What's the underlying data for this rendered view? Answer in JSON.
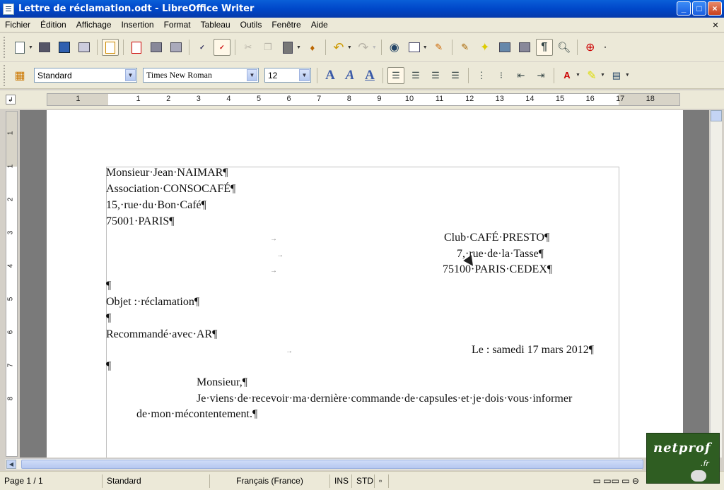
{
  "window": {
    "title": "Lettre de réclamation.odt - LibreOffice Writer",
    "buttons": {
      "minimize": "_",
      "maximize": "□",
      "close": "×"
    }
  },
  "menu": {
    "items": [
      "Fichier",
      "Édition",
      "Affichage",
      "Insertion",
      "Format",
      "Tableau",
      "Outils",
      "Fenêtre",
      "Aide"
    ],
    "close_doc": "×"
  },
  "formatting": {
    "paragraph_style": "Standard",
    "font_name": "Times New Roman",
    "font_size": "12"
  },
  "ruler": {
    "horizontal_ticks": [
      "1",
      "1",
      "2",
      "3",
      "4",
      "5",
      "6",
      "7",
      "8",
      "9",
      "10",
      "11",
      "12",
      "13",
      "14",
      "15",
      "16",
      "17",
      "18"
    ],
    "vertical_ticks": [
      "1",
      "1",
      "2",
      "3",
      "4",
      "5",
      "6",
      "7",
      "8"
    ]
  },
  "document": {
    "sender": [
      "Monsieur·Jean·NAIMAR¶",
      "Association·CONSOCAFÉ¶",
      "15,·rue·du·Bon·Café¶",
      "75001·PARIS¶"
    ],
    "recipient": [
      "Club·CAFÉ·PRESTO¶",
      "7,·rue·de·la·Tasse¶",
      "75100·PARIS·CEDEX¶"
    ],
    "tab_arrow": "→",
    "empty_para": "¶",
    "objet": "Objet :·réclamation¶",
    "recommande": "Recommandé·avec·AR¶",
    "date_line": "Le : samedi 17 mars 2012¶",
    "salutation": "Monsieur,¶",
    "body_line1": "Je·viens·de·recevoir·ma·dernière·commande·de·capsules·et·je·dois·vous·informer",
    "body_line2": "de·mon·mécontentement.¶"
  },
  "status": {
    "page": "Page 1 / 1",
    "style": "Standard",
    "language": "Français (France)",
    "insert_mode": "INS",
    "selection_mode": "STD"
  },
  "watermark": {
    "brand": "netprof",
    "tld": ".fr"
  },
  "colors": {
    "titlebar": "#0047c9",
    "chrome": "#ece9d8",
    "workspace": "#7a7a7a",
    "logo_bg": "#2f5d22"
  }
}
